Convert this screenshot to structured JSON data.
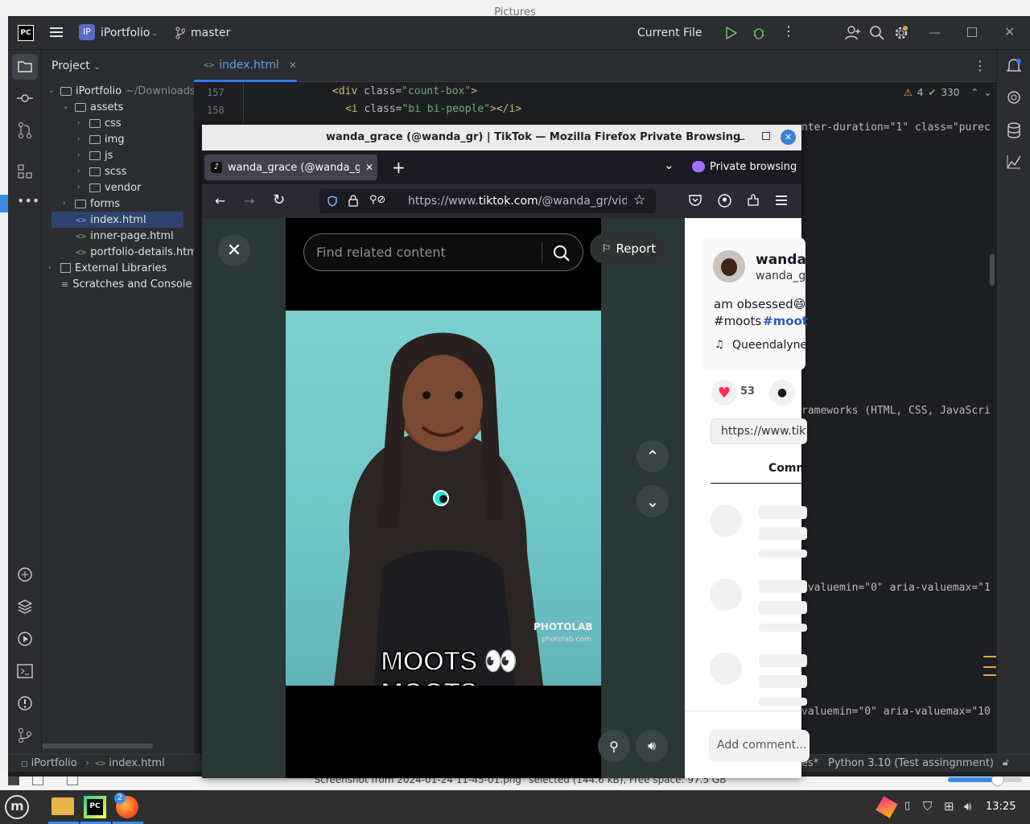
{
  "file_manager": {
    "title": "Pictures",
    "status": "\"Screenshot from 2024-01-24 11-45-01.png\" selected (144.6 kB), Free space: 97.5 GB"
  },
  "ide": {
    "app_icon_label": "PC",
    "project_badge": "IP",
    "project_name": "iPortfolio",
    "branch": "master",
    "run_config": "Current File",
    "project_panel_title": "Project",
    "tree": [
      {
        "label": "iPortfolio",
        "hint": "~/Downloads"
      },
      {
        "label": "assets"
      },
      {
        "label": "css"
      },
      {
        "label": "img"
      },
      {
        "label": "js"
      },
      {
        "label": "scss"
      },
      {
        "label": "vendor"
      },
      {
        "label": "forms"
      },
      {
        "label": "index.html"
      },
      {
        "label": "inner-page.html"
      },
      {
        "label": "portfolio-details.htm"
      },
      {
        "label": "External Libraries"
      },
      {
        "label": "Scratches and Console"
      }
    ],
    "editor_tab": "index.html",
    "warnings": "4",
    "checks": "330",
    "lines": [
      {
        "num": "157",
        "tag_open": "<div ",
        "attr": "class=",
        "value": "\"count-box\"",
        "tag_close": ">"
      },
      {
        "num": "158",
        "tag_open": "<i ",
        "attr": "class=",
        "value": "\"bi bi-people\"",
        "tag_close": "></i>"
      }
    ],
    "visible_fragments": [
      "nter-duration=\"1\" class=\"purec",
      "rameworks (HTML, CSS, JavaScri",
      "-valuemin=\"0\" aria-valuemax=\"1",
      "valuemin=\"0\" aria-valuemax=\"10"
    ],
    "breadcrumb": [
      "iPortfolio",
      "index.html"
    ],
    "status_right_partial": "es*",
    "interpreter": "Python 3.10 (Test assingnment)"
  },
  "firefox": {
    "window_title": "wanda_grace (@wanda_gr) | TikTok — Mozilla Firefox Private Browsing",
    "tab_title": "wanda_grace (@wanda_gr)",
    "private_label": "Private browsing",
    "url_prefix": "https://www.",
    "url_domain": "tiktok.com",
    "url_suffix": "/@wanda_gr/video/"
  },
  "tiktok": {
    "search_placeholder": "Find related content",
    "report_label": "Report",
    "overlay_text": "MOOTS 👀 MOOTS",
    "watermark": "PHOTOLAB",
    "watermark_sub": "photolab.com",
    "author_name": "wanda",
    "author_handle": "wanda_g",
    "caption_line1": "am obsessed😄",
    "caption_tag1": "#moots",
    "caption_tag2": "#moot",
    "music": "Queendalyne",
    "likes": "53",
    "link_partial": "https://www.tikt",
    "comments_tab": "Comm",
    "add_comment": "Add comment..."
  },
  "taskbar": {
    "pycharm_badge": "2",
    "clock": "13:25"
  },
  "colors": {
    "ide_bg": "#1e1f22",
    "ide_panel": "#2b2d30",
    "accent_blue": "#3574f0",
    "tiktok_red": "#fe2c55"
  }
}
